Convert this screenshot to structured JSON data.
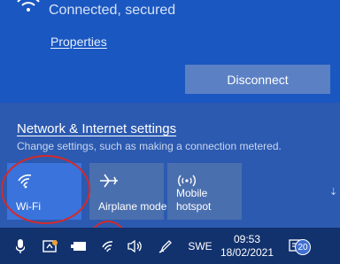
{
  "network": {
    "status": "Connected, secured",
    "properties_label": "Properties",
    "disconnect_label": "Disconnect"
  },
  "settings": {
    "title": "Network & Internet settings",
    "description": "Change settings, such as making a connection metered."
  },
  "quick_actions": [
    {
      "label": "Wi-Fi",
      "icon": "wifi-icon",
      "active": true
    },
    {
      "label": "Airplane mode",
      "icon": "airplane-icon",
      "active": false
    },
    {
      "label_line1": "Mobile",
      "label_line2": "hotspot",
      "icon": "hotspot-icon",
      "active": false
    }
  ],
  "taskbar": {
    "language": "SWE",
    "time": "09:53",
    "date": "18/02/2021",
    "notification_count": "20",
    "icons": [
      "microphone-icon",
      "app-icon",
      "battery-icon",
      "wifi-icon",
      "volume-icon",
      "pen-icon",
      "notification-icon"
    ]
  },
  "colors": {
    "accent": "#1a57c1",
    "tile_active": "#3a73db",
    "tile_inactive": "#4a6fae",
    "taskbar": "#12326e",
    "annotation": "#d42a2a"
  }
}
